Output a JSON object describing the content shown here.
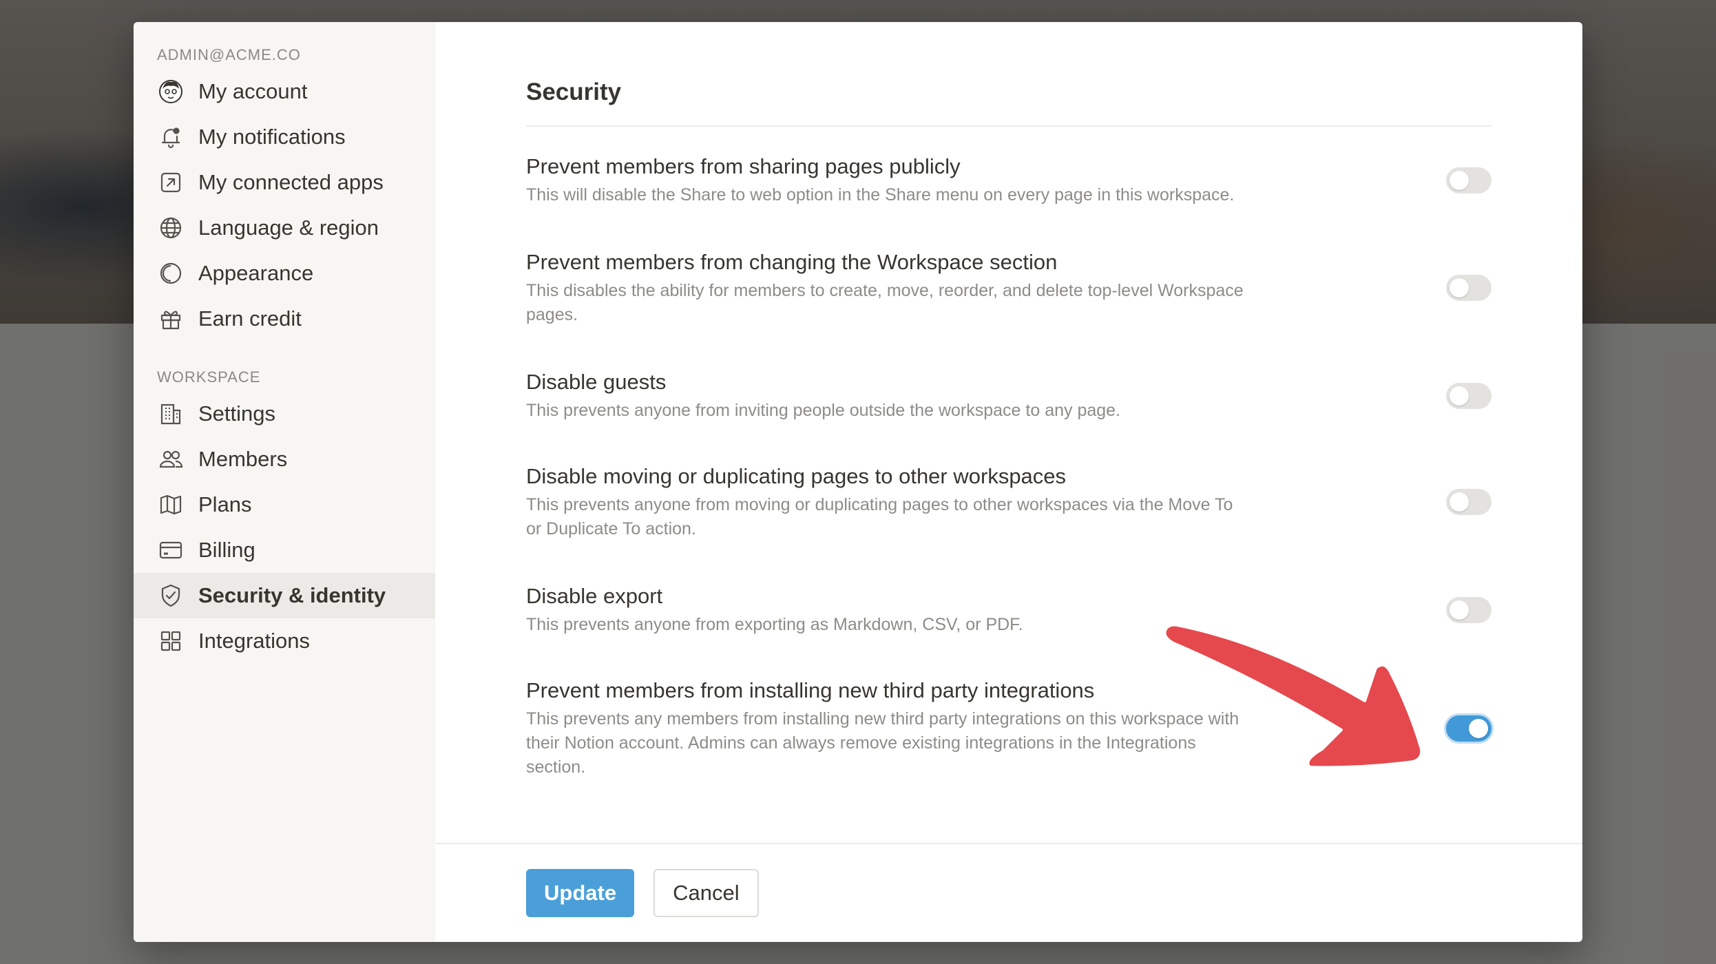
{
  "sidebar": {
    "account_header": "ADMIN@ACME.CO",
    "account_items": [
      {
        "label": "My account",
        "icon": "avatar"
      },
      {
        "label": "My notifications",
        "icon": "bell-icon"
      },
      {
        "label": "My connected apps",
        "icon": "external-link-icon"
      },
      {
        "label": "Language & region",
        "icon": "globe-icon"
      },
      {
        "label": "Appearance",
        "icon": "moon-icon"
      },
      {
        "label": "Earn credit",
        "icon": "gift-icon"
      }
    ],
    "workspace_header": "WORKSPACE",
    "workspace_items": [
      {
        "label": "Settings",
        "icon": "building-icon"
      },
      {
        "label": "Members",
        "icon": "people-icon"
      },
      {
        "label": "Plans",
        "icon": "map-icon"
      },
      {
        "label": "Billing",
        "icon": "credit-card-icon"
      },
      {
        "label": "Security & identity",
        "icon": "shield-icon",
        "active": true
      },
      {
        "label": "Integrations",
        "icon": "grid-icon"
      }
    ]
  },
  "main": {
    "title": "Security",
    "settings": [
      {
        "title": "Prevent members from sharing pages publicly",
        "description": "This will disable the Share to web option in the Share menu on every page in this workspace.",
        "enabled": false
      },
      {
        "title": "Prevent members from changing the Workspace section",
        "description": "This disables the ability for members to create, move, reorder, and delete top-level Workspace pages.",
        "enabled": false
      },
      {
        "title": "Disable guests",
        "description": "This prevents anyone from inviting people outside the workspace to any page.",
        "enabled": false
      },
      {
        "title": "Disable moving or duplicating pages to other workspaces",
        "description": "This prevents anyone from moving or duplicating pages to other workspaces via the Move To or Duplicate To action.",
        "enabled": false
      },
      {
        "title": "Disable export",
        "description": "This prevents anyone from exporting as Markdown, CSV, or PDF.",
        "enabled": false
      },
      {
        "title": "Prevent members from installing new third party integrations",
        "description": "This prevents any members from installing new third party integrations on this workspace with their Notion account. Admins can always remove existing integrations in the Integrations section.",
        "enabled": true
      }
    ]
  },
  "footer": {
    "update_label": "Update",
    "cancel_label": "Cancel"
  },
  "colors": {
    "accent": "#4b9fd8",
    "toggle_on": "#4199d8",
    "annotation_arrow": "#e5484d"
  }
}
